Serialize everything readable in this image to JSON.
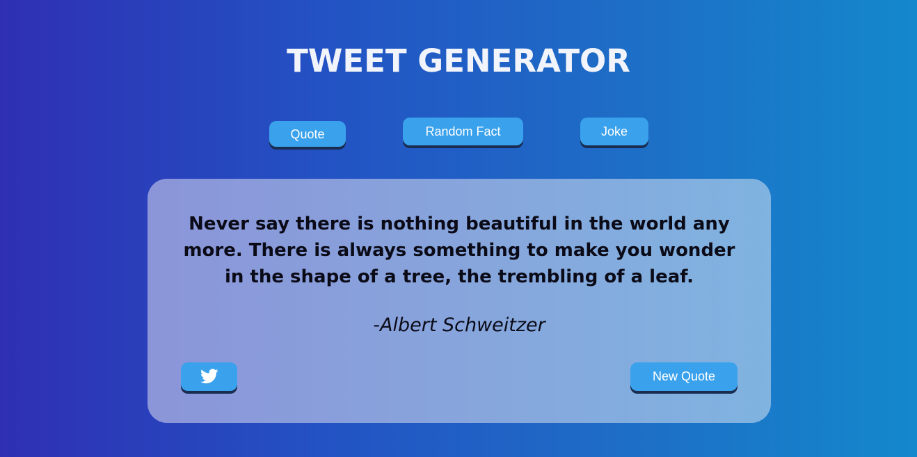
{
  "app": {
    "title": "TWEET GENERATOR"
  },
  "categories": [
    {
      "label": "Quote"
    },
    {
      "label": "Random Fact"
    },
    {
      "label": "Joke"
    }
  ],
  "quote_card": {
    "text": "Never say there is nothing beautiful in the world any more. There is always something to make you wonder in the shape of a tree, the trembling of a leaf.",
    "author": "-Albert Schweitzer",
    "tweet_button_icon": "twitter-icon",
    "new_button_label": "New Quote"
  },
  "colors": {
    "button": "#3aa1ec",
    "button_shadow": "#1a2c50",
    "title": "#f2f4fb",
    "text": "#0b0b18"
  }
}
